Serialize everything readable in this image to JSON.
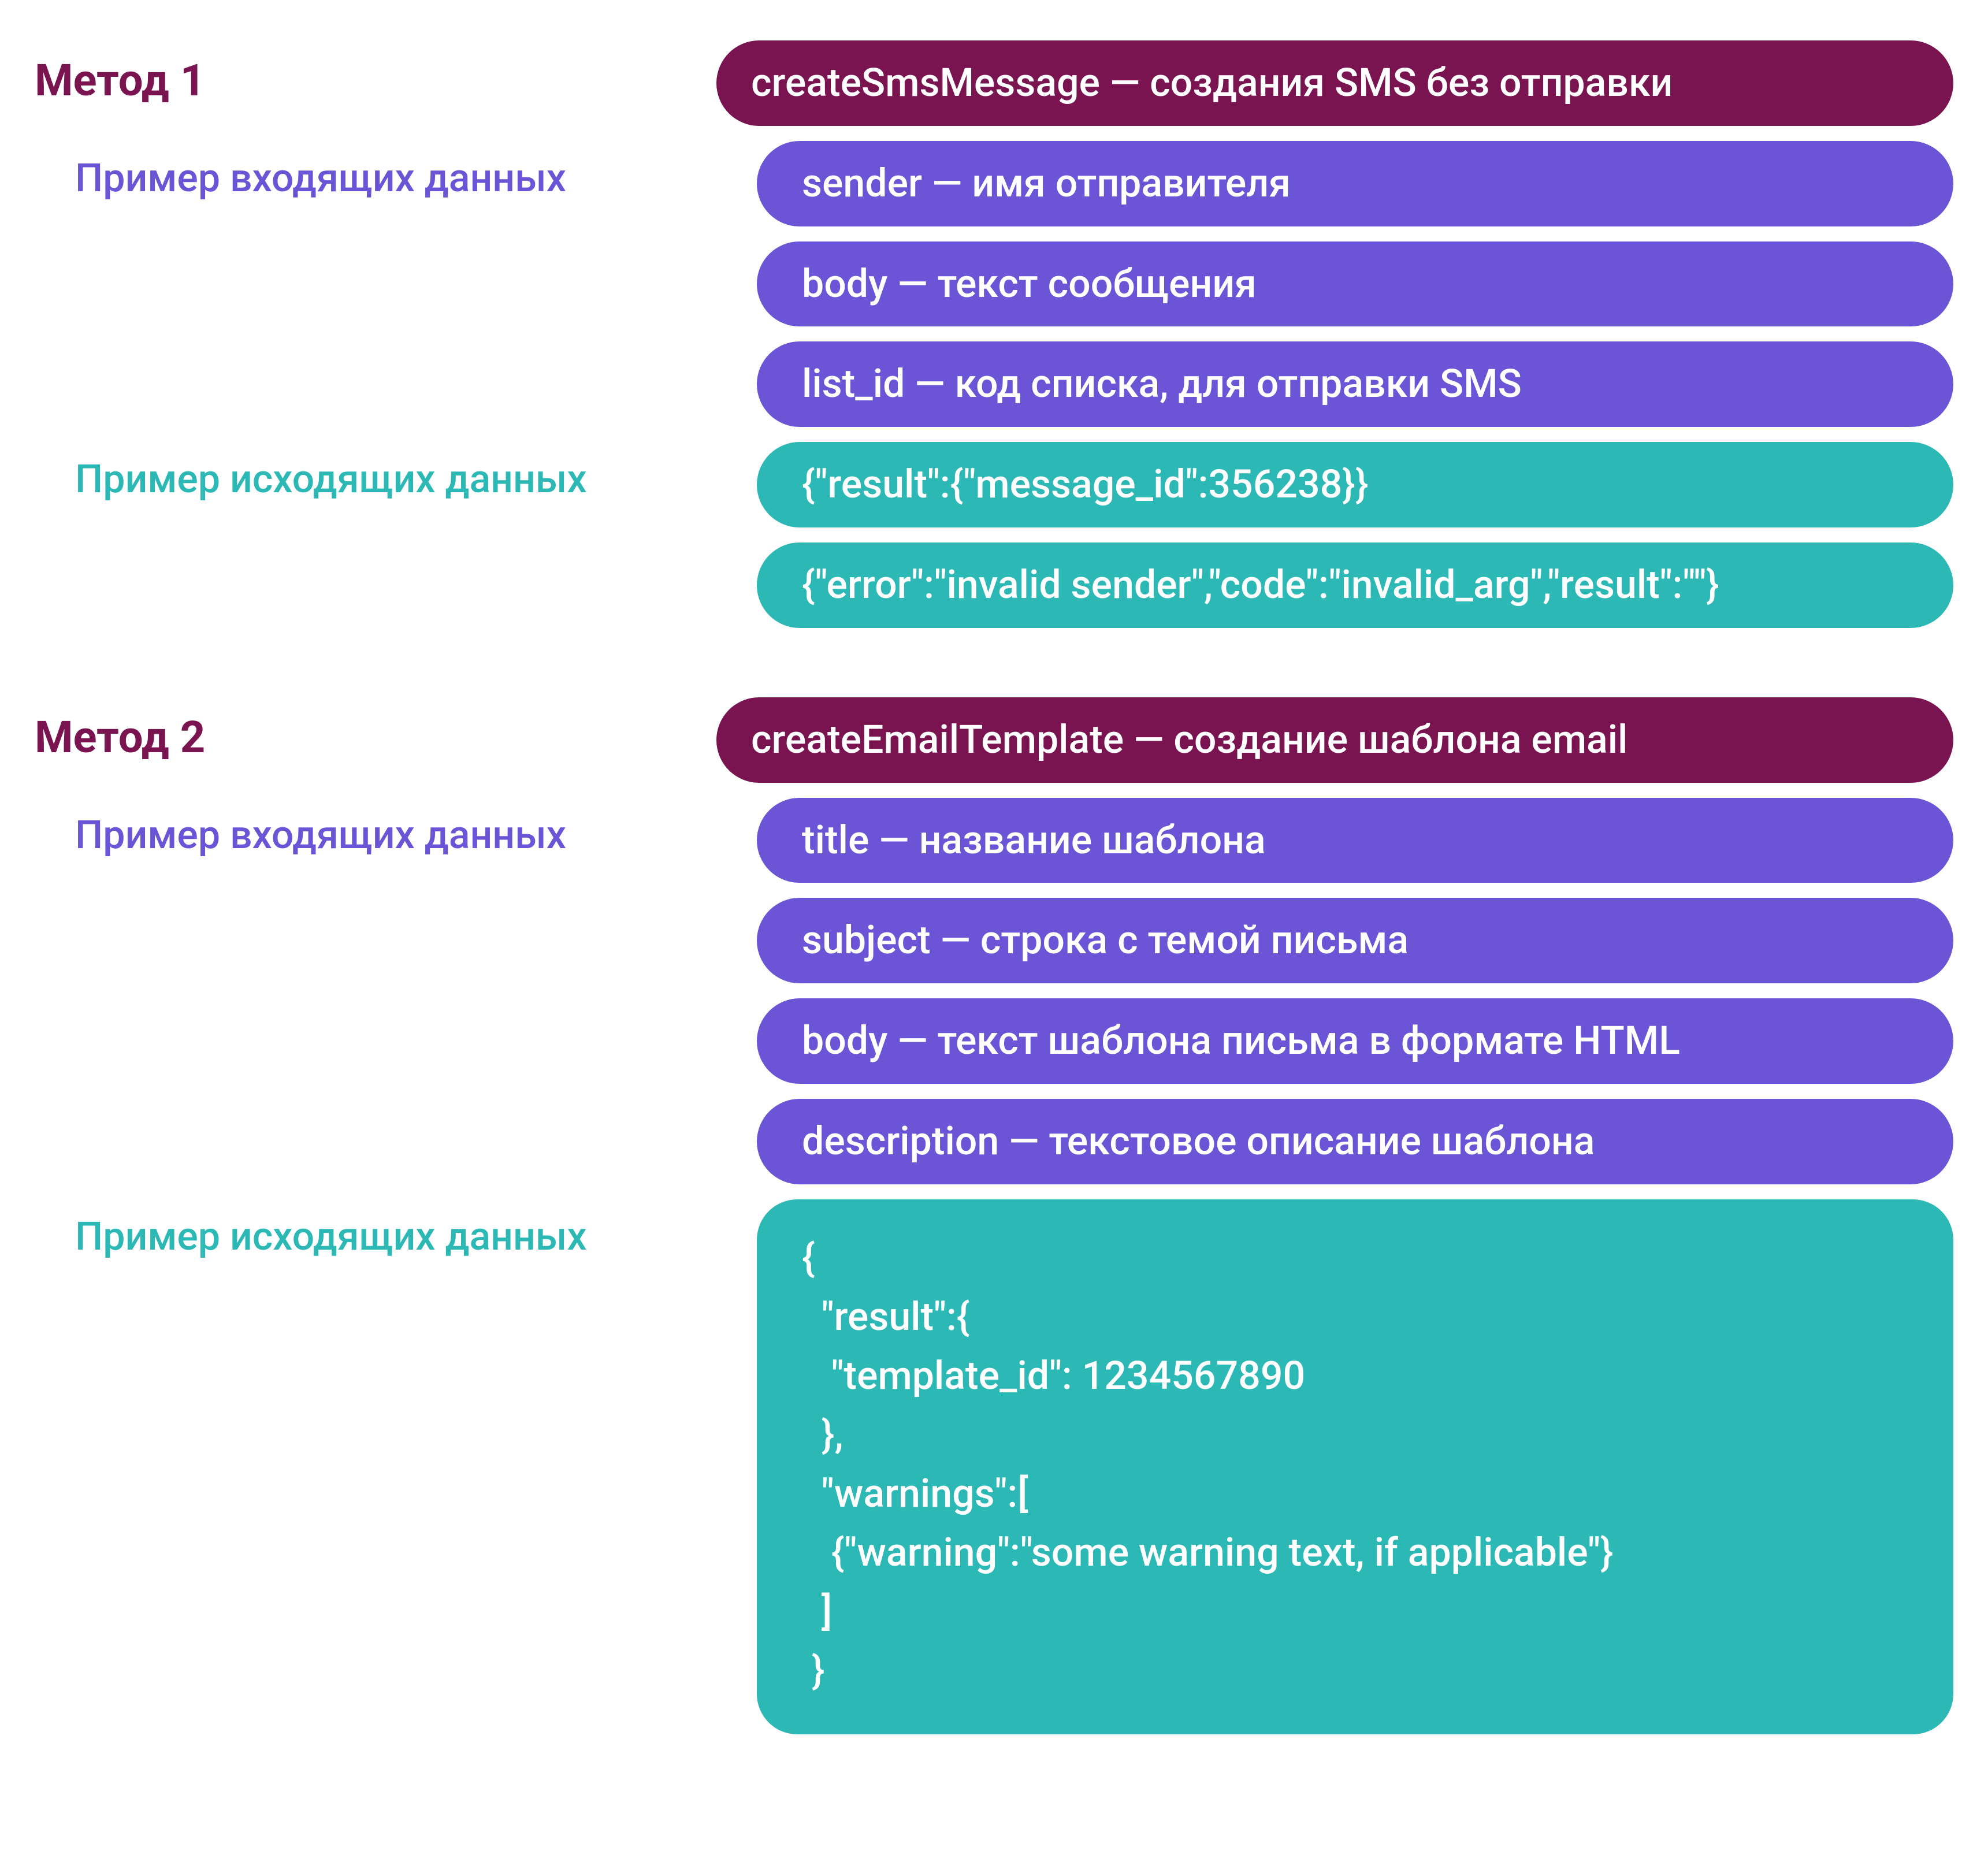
{
  "methods": [
    {
      "heading": "Метод 1",
      "title": "createSmsMessage — создания SMS без отправки",
      "input_label": "Пример входящих данных",
      "inputs": [
        "sender — имя отправителя",
        "body — текст сообщения",
        "list_id — код списка, для отправки SMS"
      ],
      "output_label": "Пример исходящих данных",
      "outputs": [
        "{\"result\":{\"message_id\":356238}}",
        "{\"error\":\"invalid sender\",\"code\":\"invalid_arg\",\"result\":\"\"}"
      ],
      "output_block": null
    },
    {
      "heading": "Метод 2",
      "title": "createEmailTemplate — создание шаблона email",
      "input_label": "Пример входящих данных",
      "inputs": [
        "title — название шаблона",
        "subject — строка с темой письма",
        "body — текст шаблона письма в формате HTML",
        "description — текстовое описание шаблона"
      ],
      "output_label": "Пример исходящих данных",
      "outputs": [],
      "output_block": "{\n  \"result\":{\n   \"template_id\": 1234567890\n  },\n  \"warnings\":[\n   {\"warning\":\"some warning text, if applicable\"}\n  ]\n }"
    }
  ],
  "colors": {
    "heading": "#7a1451",
    "input": "#6b55d6",
    "output": "#2cb8b4"
  }
}
